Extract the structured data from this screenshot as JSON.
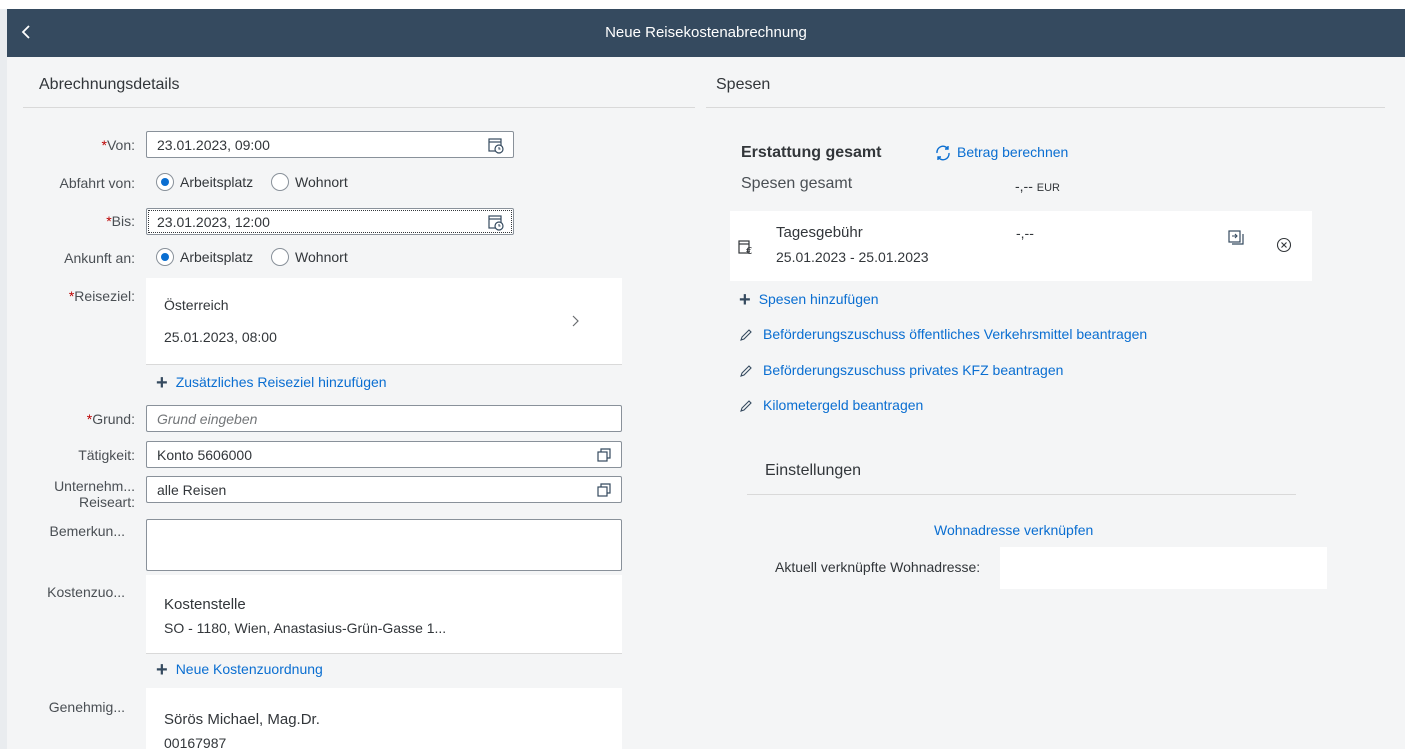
{
  "shell": {
    "title": "Neue Reisekostenabrechnung"
  },
  "details": {
    "title": "Abrechnungsdetails",
    "von": {
      "label": "Von:",
      "value": "23.01.2023, 09:00"
    },
    "abfahrt": {
      "label": "Abfahrt von:",
      "opt1": "Arbeitsplatz",
      "opt2": "Wohnort"
    },
    "bis": {
      "label": "Bis:",
      "value": "23.01.2023, 12:00"
    },
    "ankunft": {
      "label": "Ankunft an:",
      "opt1": "Arbeitsplatz",
      "opt2": "Wohnort"
    },
    "reiseziel": {
      "label": "Reiseziel:",
      "country": "Österreich",
      "date": "25.01.2023, 08:00"
    },
    "add_reiseziel": "Zusätzliches Reiseziel hinzufügen",
    "grund": {
      "label": "Grund:",
      "placeholder": "Grund eingeben"
    },
    "taetigkeit": {
      "label": "Tätigkeit:",
      "value": "Konto 5606000"
    },
    "reiseart": {
      "label1": "Unternehm...",
      "label2": "Reiseart:",
      "value": "alle Reisen"
    },
    "bemerkung": {
      "label": "Bemerkun..."
    },
    "kosten": {
      "label": "Kostenzuo...",
      "title": "Kostenstelle",
      "detail": "SO - 1180, Wien, Anastasius-Grün-Gasse 1..."
    },
    "add_kosten": "Neue Kostenzuordnung",
    "genehmig": {
      "label": "Genehmig...",
      "name": "Sörös Michael, Mag.Dr.",
      "id": "00167987"
    }
  },
  "spesen": {
    "title": "Spesen",
    "erstattung_label": "Erstattung gesamt",
    "betrag_link": "Betrag berechnen",
    "spesen_gesamt_label": "Spesen gesamt",
    "spesen_gesamt_value": "-,--",
    "spesen_gesamt_currency": "EUR",
    "item": {
      "title": "Tagesgebühr",
      "dates": "25.01.2023 - 25.01.2023",
      "amount": "-,--"
    },
    "actions": [
      "Spesen hinzufügen",
      "Beförderungszuschuss öffentliches Verkehrsmittel beantragen",
      "Beförderungszuschuss privates KFZ beantragen",
      "Kilometergeld beantragen"
    ],
    "einstellungen": {
      "title": "Einstellungen",
      "link": "Wohnadresse verknüpfen",
      "current_label": "Aktuell verknüpfte Wohnadresse:"
    }
  }
}
